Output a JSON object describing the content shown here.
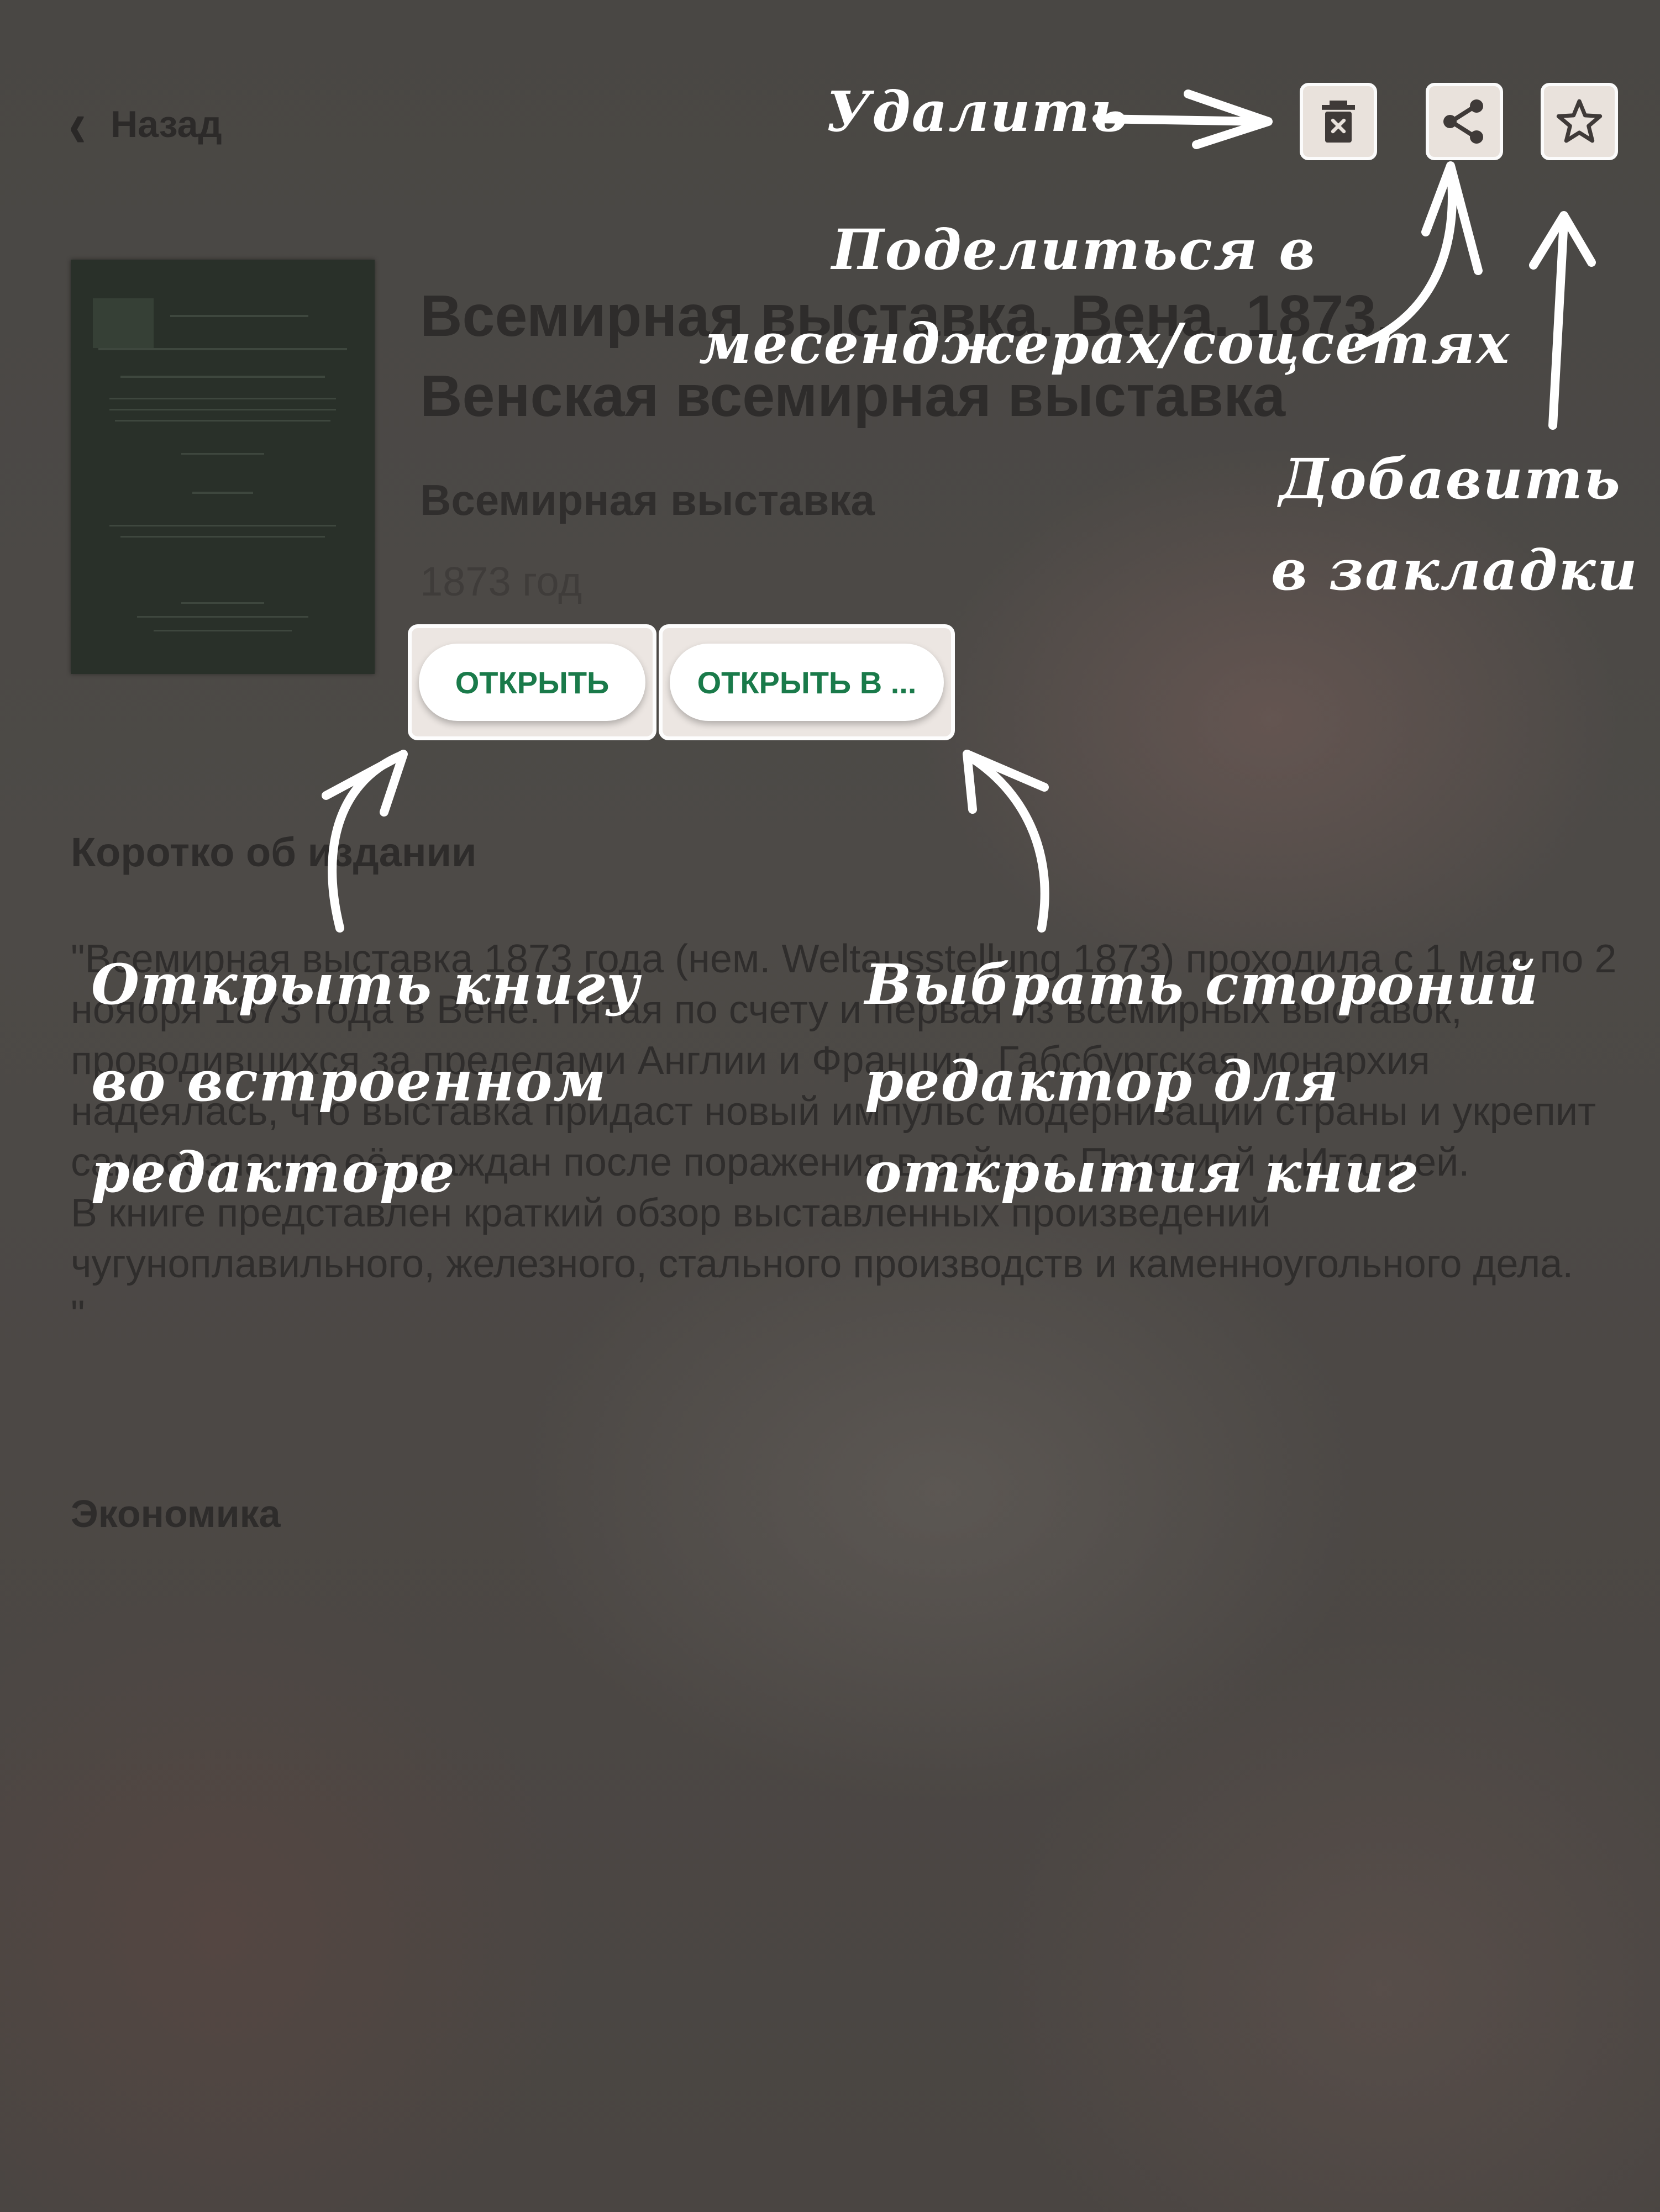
{
  "header": {
    "back_label": "Назад"
  },
  "book": {
    "title": "Всемирная выставка. Вена. 1873. Венская всемирная выставка",
    "series": "Всемирная выставка",
    "year": "1873 год"
  },
  "actions": {
    "open_label": "ОТКРЫТЬ",
    "open_in_label": "ОТКРЫТЬ В ..."
  },
  "about": {
    "heading": "Коротко об издании",
    "paragraphs": [
      "\"Всемирная выставка 1873 года (нем. Weltausstellung 1873) проходила с 1 мая по 2 ноября 1873 года в Вене. Пятая по счету и первая из всемирных выставок, проводившихся за пределами Англии и Франции. Габсбургская монархия надеялась, что выставка придаст новый импульс модернизации страны и укрепит самосознание её граждан после поражения в войне с Пруссией и Италией.",
      "В книге представлен краткий обзор выставленных произведений чугуноплавильного, железного, стального производств и каменноугольного дела.",
      "\""
    ]
  },
  "category": "Экономика",
  "annotations": {
    "delete": "Удалить",
    "share_line1": "Поделиться в",
    "share_line2": "месенджерах/соцсетях",
    "bookmark_line1": "Добавить",
    "bookmark_line2": "в закладки",
    "open_line1": "Открыть книгу",
    "open_line2": "во встроенном",
    "open_line3": "редакторе",
    "open_in_line1": "Выбрать стороний",
    "open_in_line2": "редактор для",
    "open_in_line3": "открытия книг"
  },
  "icons": {
    "back": "chevron-left-icon",
    "delete": "trash-icon",
    "share": "share-icon",
    "bookmark": "star-icon"
  },
  "colors": {
    "accent_text": "#1a7a4a",
    "overlay": "#4a4744",
    "annotation": "#ffffff"
  }
}
